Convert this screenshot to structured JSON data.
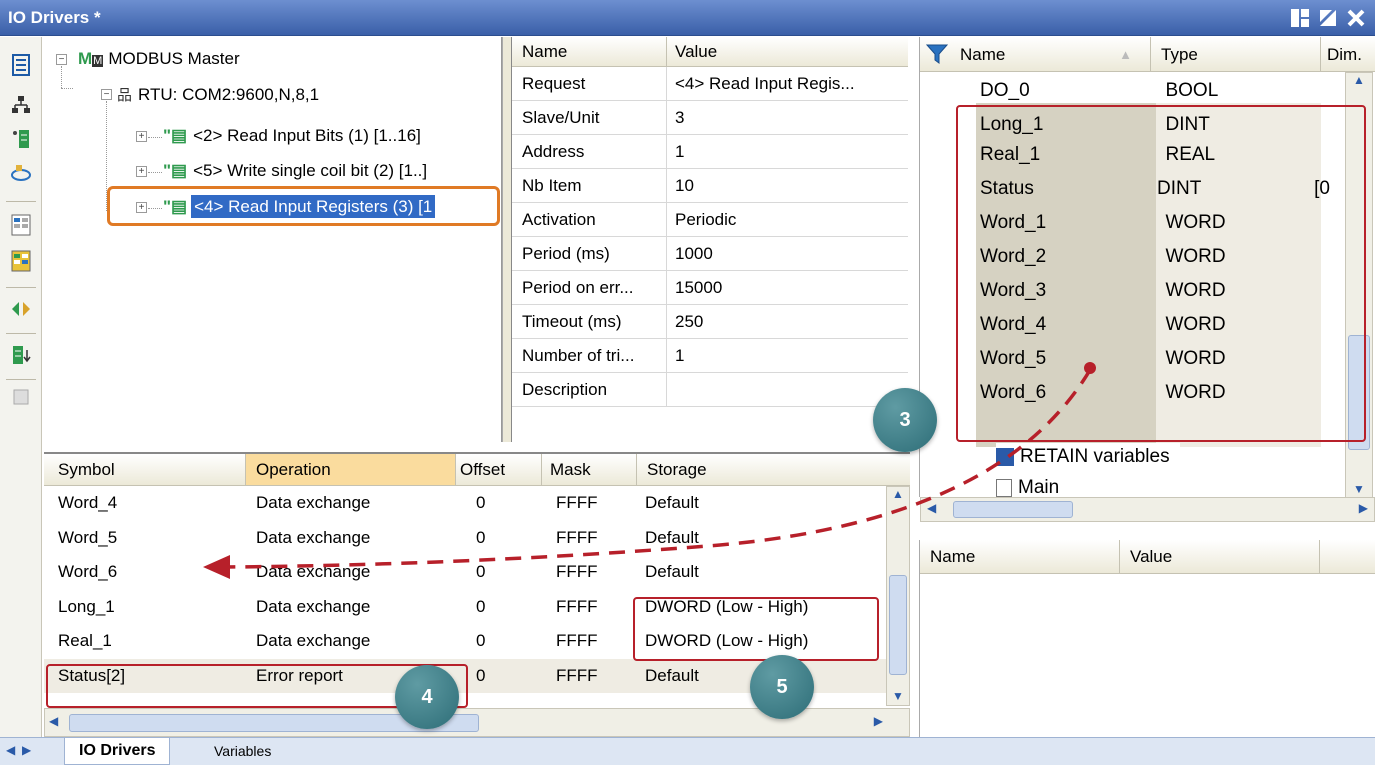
{
  "window": {
    "title": "IO Drivers *"
  },
  "tree": {
    "master": "MODBUS Master",
    "rtu": "RTU: COM2:9600,N,8,1",
    "req1": "<2> Read Input Bits (1) [1..16]",
    "req2": "<5> Write single coil bit (2) [1..]",
    "req3": "<4> Read Input Registers (3) [1"
  },
  "props": {
    "headers": {
      "name": "Name",
      "value": "Value"
    },
    "rows": [
      {
        "name": "Request",
        "value": "<4> Read Input Regis..."
      },
      {
        "name": "Slave/Unit",
        "value": "3"
      },
      {
        "name": "Address",
        "value": "1"
      },
      {
        "name": "Nb Item",
        "value": "10"
      },
      {
        "name": "Activation",
        "value": "Periodic"
      },
      {
        "name": "Period (ms)",
        "value": "1000"
      },
      {
        "name": "Period on err...",
        "value": "15000"
      },
      {
        "name": "Timeout (ms)",
        "value": "250"
      },
      {
        "name": "Number of tri...",
        "value": "1"
      },
      {
        "name": "Description",
        "value": ""
      }
    ]
  },
  "vars": {
    "headers": {
      "name": "Name",
      "type": "Type",
      "dim": "Dim."
    },
    "rows": [
      {
        "name": "DO_0",
        "type": "BOOL",
        "dim": ""
      },
      {
        "name": "Long_1",
        "type": "DINT",
        "dim": ""
      },
      {
        "name": "Real_1",
        "type": "REAL",
        "dim": ""
      },
      {
        "name": "Status",
        "type": "DINT",
        "dim": "[0"
      },
      {
        "name": "Word_1",
        "type": "WORD",
        "dim": ""
      },
      {
        "name": "Word_2",
        "type": "WORD",
        "dim": ""
      },
      {
        "name": "Word_3",
        "type": "WORD",
        "dim": ""
      },
      {
        "name": "Word_4",
        "type": "WORD",
        "dim": ""
      },
      {
        "name": "Word_5",
        "type": "WORD",
        "dim": ""
      },
      {
        "name": "Word_6",
        "type": "WORD",
        "dim": ""
      }
    ],
    "retain": "RETAIN variables",
    "main": "Main"
  },
  "nv": {
    "name": "Name",
    "value": "Value"
  },
  "bottom": {
    "headers": {
      "symbol": "Symbol",
      "operation": "Operation",
      "offset": "Offset",
      "mask": "Mask",
      "storage": "Storage"
    },
    "rows": [
      {
        "symbol": "Word_4",
        "operation": "Data exchange",
        "offset": "0",
        "mask": "FFFF",
        "storage": "Default"
      },
      {
        "symbol": "Word_5",
        "operation": "Data exchange",
        "offset": "0",
        "mask": "FFFF",
        "storage": "Default"
      },
      {
        "symbol": "Word_6",
        "operation": "Data exchange",
        "offset": "0",
        "mask": "FFFF",
        "storage": "Default"
      },
      {
        "symbol": "Long_1",
        "operation": "Data exchange",
        "offset": "0",
        "mask": "FFFF",
        "storage": "DWORD (Low - High)"
      },
      {
        "symbol": "Real_1",
        "operation": "Data exchange",
        "offset": "0",
        "mask": "FFFF",
        "storage": "DWORD (Low - High)"
      },
      {
        "symbol": "Status[2]",
        "operation": "Error report",
        "offset": "0",
        "mask": "FFFF",
        "storage": "Default"
      }
    ]
  },
  "tabs": {
    "active": "IO Drivers",
    "other": "Variables"
  },
  "callouts": {
    "c3": "3",
    "c4": "4",
    "c5": "5"
  },
  "colors": {
    "accent_red": "#b7202a",
    "highlight_orange": "#e07a25",
    "selection_blue": "#316ac5",
    "callout_teal": "#3b7e88"
  }
}
